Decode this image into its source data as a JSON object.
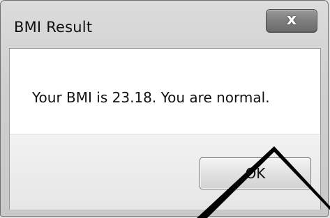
{
  "window": {
    "title": "BMI Result",
    "close_glyph": "x"
  },
  "message": {
    "text": "Your BMI is 23.18. You are normal."
  },
  "buttons": {
    "ok_label": "OK"
  },
  "icons": {
    "close": "close-icon"
  }
}
